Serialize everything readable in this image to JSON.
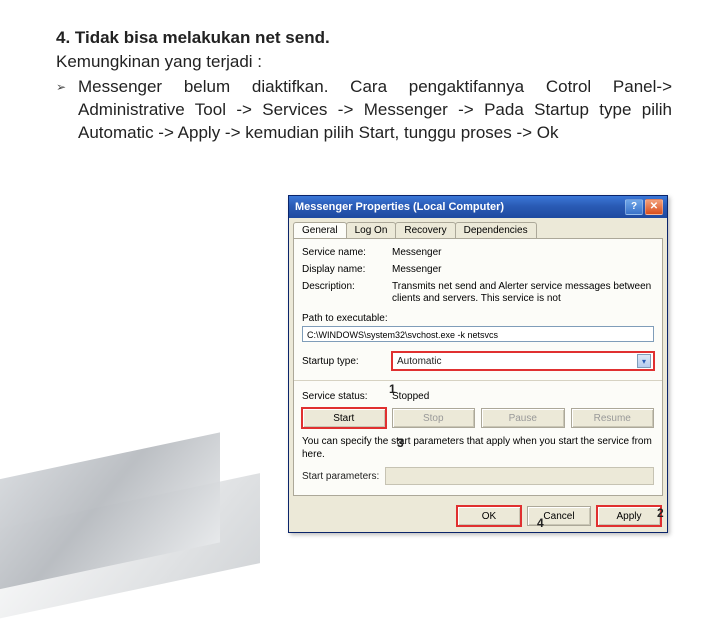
{
  "doc": {
    "heading": "4. Tidak bisa melakukan net send.",
    "subheading": "Kemungkinan yang terjadi :",
    "bullet": "Messenger belum diaktifkan. Cara pengaktifannya Cotrol Panel-> Administrative Tool -> Services -> Messenger -> Pada Startup type pilih Automatic -> Apply -> kemudian pilih Start, tunggu proses -> Ok"
  },
  "dialog": {
    "title": "Messenger Properties (Local Computer)",
    "help_glyph": "?",
    "close_glyph": "✕",
    "tabs": [
      "General",
      "Log On",
      "Recovery",
      "Dependencies"
    ],
    "labels": {
      "service_name": "Service name:",
      "display_name": "Display name:",
      "description": "Description:",
      "path_label": "Path to executable:",
      "startup_type": "Startup type:",
      "service_status": "Service status:",
      "start_params": "Start parameters:"
    },
    "values": {
      "service_name": "Messenger",
      "display_name": "Messenger",
      "description": "Transmits net send and Alerter service messages between clients and servers. This service is not",
      "path": "C:\\WINDOWS\\system32\\svchost.exe -k netsvcs",
      "startup_type": "Automatic",
      "service_status": "Stopped"
    },
    "note": "You can specify the start parameters that apply when you start the service from here.",
    "buttons": {
      "start": "Start",
      "stop": "Stop",
      "pause": "Pause",
      "resume": "Resume",
      "ok": "OK",
      "cancel": "Cancel",
      "apply": "Apply"
    }
  },
  "callouts": {
    "c1": "1",
    "c2": "2",
    "c3": "3",
    "c4": "4"
  }
}
